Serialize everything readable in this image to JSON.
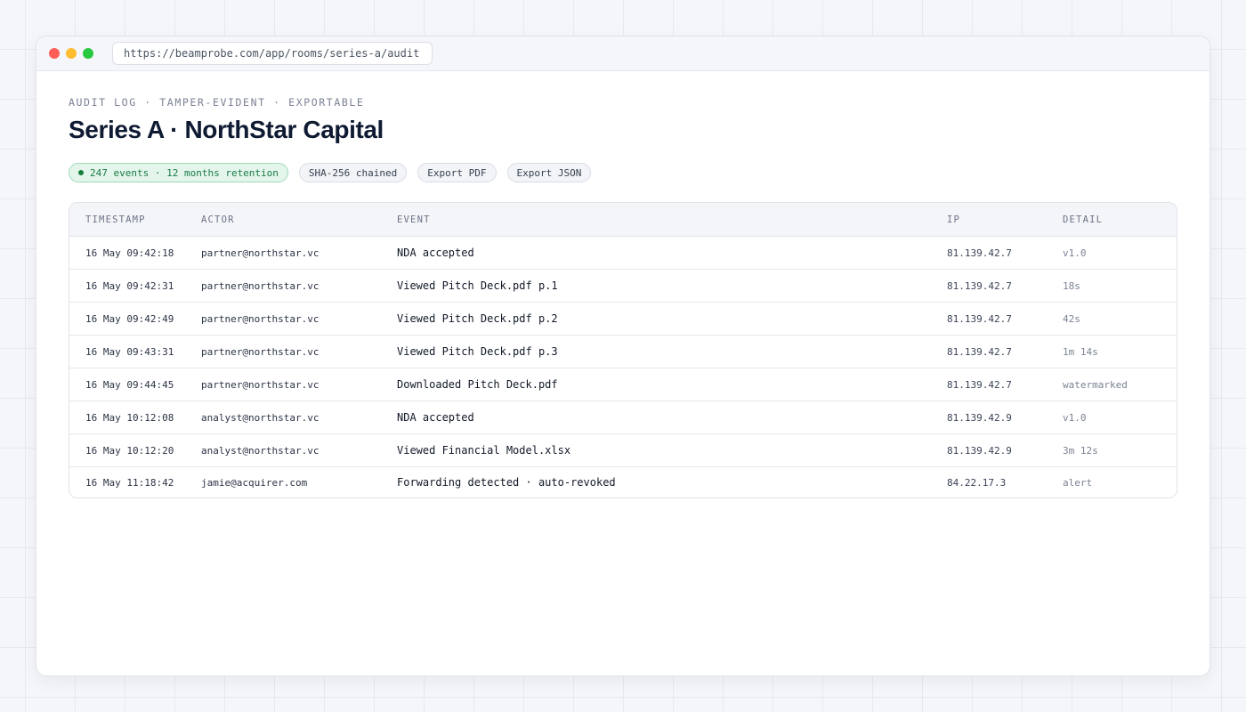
{
  "browser": {
    "url": "https://beamprobe.com/app/rooms/series-a/audit"
  },
  "header": {
    "eyebrow": "AUDIT LOG · TAMPER-EVIDENT · EXPORTABLE",
    "title": "Series A · NorthStar Capital"
  },
  "chips": {
    "events": "247 events · 12 months retention",
    "hash": "SHA-256 chained",
    "export_pdf": "Export PDF",
    "export_json": "Export JSON"
  },
  "table": {
    "columns": [
      "TIMESTAMP",
      "ACTOR",
      "EVENT",
      "IP",
      "DETAIL"
    ],
    "rows": [
      {
        "timestamp": "16 May 09:42:18",
        "actor": "partner@northstar.vc",
        "event": "NDA accepted",
        "ip": "81.139.42.7",
        "detail": "v1.0"
      },
      {
        "timestamp": "16 May 09:42:31",
        "actor": "partner@northstar.vc",
        "event": "Viewed Pitch Deck.pdf p.1",
        "ip": "81.139.42.7",
        "detail": "18s"
      },
      {
        "timestamp": "16 May 09:42:49",
        "actor": "partner@northstar.vc",
        "event": "Viewed Pitch Deck.pdf p.2",
        "ip": "81.139.42.7",
        "detail": "42s"
      },
      {
        "timestamp": "16 May 09:43:31",
        "actor": "partner@northstar.vc",
        "event": "Viewed Pitch Deck.pdf p.3",
        "ip": "81.139.42.7",
        "detail": "1m 14s"
      },
      {
        "timestamp": "16 May 09:44:45",
        "actor": "partner@northstar.vc",
        "event": "Downloaded Pitch Deck.pdf",
        "ip": "81.139.42.7",
        "detail": "watermarked"
      },
      {
        "timestamp": "16 May 10:12:08",
        "actor": "analyst@northstar.vc",
        "event": "NDA accepted",
        "ip": "81.139.42.9",
        "detail": "v1.0"
      },
      {
        "timestamp": "16 May 10:12:20",
        "actor": "analyst@northstar.vc",
        "event": "Viewed Financial Model.xlsx",
        "ip": "81.139.42.9",
        "detail": "3m 12s"
      },
      {
        "timestamp": "16 May 11:18:42",
        "actor": "jamie@acquirer.com",
        "event": "Forwarding detected · auto-revoked",
        "ip": "84.22.17.3",
        "detail": "alert"
      }
    ]
  },
  "colors": {
    "status_green": "#15803d",
    "title": "#0f1a33"
  }
}
